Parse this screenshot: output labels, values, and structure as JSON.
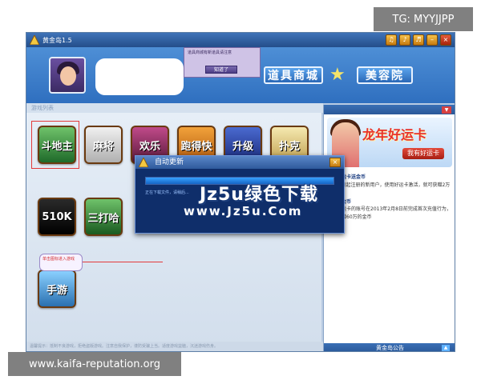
{
  "overlays": {
    "top_right_tag": "TG: MYYJJPP",
    "bottom_left_tag": "www.kaifa-reputation.org"
  },
  "window": {
    "title": "黄金岛1.5",
    "controls": [
      "♫",
      "♪",
      "♬",
      "–",
      "×"
    ]
  },
  "header": {
    "tooltip_text": "道具商城有新道具请注意",
    "tooltip_button": "知道了",
    "shop_items_label": "道具商城",
    "shop_beauty_label": "美容院"
  },
  "games": {
    "section_label": "游戏列表",
    "tiles": [
      {
        "label": "斗地主",
        "color_top": "#6fc26a",
        "color_bottom": "#1f6a2a"
      },
      {
        "label": "麻将",
        "color_top": "#f0f0f0",
        "color_bottom": "#b0b0b0"
      },
      {
        "label": "欢乐",
        "color_top": "#c04a8a",
        "color_bottom": "#5a1a3a"
      },
      {
        "label": "跑得快",
        "color_top": "#f2a23a",
        "color_bottom": "#b05a10"
      },
      {
        "label": "升级",
        "color_top": "#4a6ad0",
        "color_bottom": "#1a2a7a"
      },
      {
        "label": "扑克",
        "color_top": "#f5e9b0",
        "color_bottom": "#c0a050"
      },
      {
        "label": "510K",
        "color_top": "#2a2a2a",
        "color_bottom": "#000000"
      },
      {
        "label": "三打哈",
        "color_top": "#6fc26a",
        "color_bottom": "#1a5a20"
      },
      {
        "label": "手游",
        "color_top": "#8ad0ff",
        "color_bottom": "#2a70b0"
      }
    ],
    "hint_text": "单击图标进入游戏"
  },
  "right_panel": {
    "banner_title": "龙年好运卡",
    "banner_button": "我有好运卡",
    "news": [
      {
        "head": "激活好运卡送金币",
        "body": "9月28日起注册的新用户，使用好运卡激活，就可获赠2万金币"
      },
      {
        "head": "充值送金币",
        "body": "激活好运卡的账号在2013年2月8日前完成首次充值行为，即可获赠60万的金币"
      }
    ],
    "footer_label": "黄金岛公告"
  },
  "dialog": {
    "title": "自动更新",
    "status": "正在下载文件，请稍后...",
    "progress": 1.0,
    "watermark_line1": "Jz5u绿色下载",
    "watermark_line2": "www.Jz5u.Com"
  },
  "status_bar": {
    "text": "温馨提示：抵制不良游戏，拒绝盗版游戏。注意自我保护，谨防受骗上当。适度游戏益脑，沉迷游戏伤身。"
  }
}
